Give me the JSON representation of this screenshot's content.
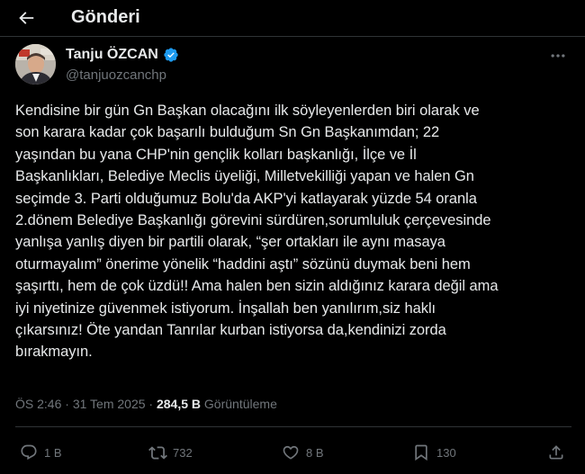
{
  "header": {
    "title": "Gönderi",
    "back_icon": "arrow-left-icon"
  },
  "author": {
    "name": "Tanju ÖZCAN",
    "handle": "@tanjuozcanchp",
    "verified_color": "#1d9bf0"
  },
  "tweet": {
    "text": "Kendisine bir gün Gn Başkan olacağını ilk söyleyenlerden biri olarak ve\nson karara kadar çok başarılı bulduğum Sn Gn Başkanımdan; 22\nyaşından bu yana CHP'nin gençlik kolları başkanlığı, İlçe ve İl\nBaşkanlıkları, Belediye Meclis üyeliği, Milletvekilliği yapan ve halen Gn\nseçimde 3. Parti olduğumuz Bolu'da AKP'yi katlayarak yüzde 54 oranla\n2.dönem Belediye Başkanlığı görevini sürdüren,sorumluluk çerçevesinde\nyanlışa yanlış diyen bir partili olarak, “şer ortakları ile aynı masaya\noturmayalım” önerime yönelik “haddini aştı” sözünü duymak beni hem\nşaşırttı, hem de çok üzdü!! Ama halen ben sizin aldığınız karara değil ama\niyi niyetinize güvenmek istiyorum. İnşallah ben yanılırım,siz haklı\nçıkarsınız! Öte yandan Tanrılar kurban istiyorsa da,kendinizi zorda\nbırakmayın."
  },
  "meta": {
    "time": "ÖS 2:46",
    "separator": " · ",
    "date": "31 Tem 2025",
    "views_count": "284,5 B",
    "views_label": "Görüntüleme"
  },
  "actions": {
    "replies": "1 B",
    "reposts": "732",
    "likes": "8 B",
    "bookmarks": "130"
  },
  "colors": {
    "background": "#000000",
    "text": "#e7e9ea",
    "muted": "#71767b",
    "border": "#2f3336",
    "accent": "#1d9bf0"
  }
}
